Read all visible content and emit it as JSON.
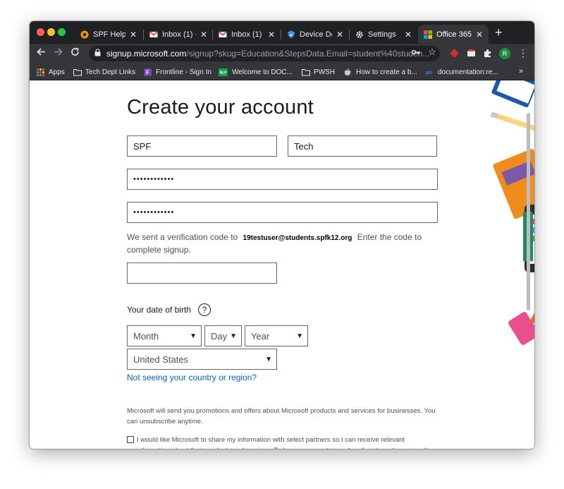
{
  "tabs": [
    {
      "title": "SPF Help D",
      "close": "✕"
    },
    {
      "title": "Inbox (1) -",
      "close": "✕"
    },
    {
      "title": "Inbox (1) -",
      "close": "✕"
    },
    {
      "title": "Device Det",
      "close": "✕"
    },
    {
      "title": "Settings",
      "close": "✕"
    },
    {
      "title": "Office 365",
      "close": "✕"
    }
  ],
  "new_tab_label": "+",
  "address": {
    "host": "signup.microsoft.com",
    "path": "/signup?skug=Education&StepsData.Email=student%40studen..."
  },
  "avatar_initial": "R",
  "bookmarks": [
    {
      "label": "Apps",
      "icon": "apps-grid-icon"
    },
    {
      "label": "Tech Dept Links",
      "icon": "folder-icon"
    },
    {
      "label": "Frontline - Sign In",
      "icon": "frontline-icon"
    },
    {
      "label": "Welcome to DOC...",
      "icon": "nlp-icon"
    },
    {
      "label": "PWSH",
      "icon": "folder-icon"
    },
    {
      "label": "How to create a b...",
      "icon": "apple-icon"
    },
    {
      "label": "documentation:re...",
      "icon": "spf-icon"
    }
  ],
  "bookmarks_more": "»",
  "form": {
    "heading": "Create your account",
    "first_name": "SPF",
    "last_name": "Tech",
    "password": "••••••••••••",
    "confirm_password": "••••••••••••",
    "verify_prefix": "We sent a verification code to",
    "verify_email": "19testuser@students.spfk12.org",
    "verify_suffix": "Enter the code to complete signup.",
    "verification_code": "",
    "dob_label": "Your date of birth",
    "help_label": "?",
    "month": "Month",
    "day": "Day",
    "year": "Year",
    "country": "United States",
    "country_link": "Not seeing your country or region?",
    "promo_text": "Microsoft will send you promotions and offers about Microsoft products and services for businesses. You can unsubscribe anytime.",
    "consent_text": "I would like Microsoft to share my information with select partners so I can receive relevant information about their products and services. To learn more, or to unsubscribe at any time, view the"
  },
  "colors": {
    "tab_bar": "#202124",
    "toolbar": "#35363a",
    "link": "#0067b8",
    "input_border": "#666666"
  }
}
